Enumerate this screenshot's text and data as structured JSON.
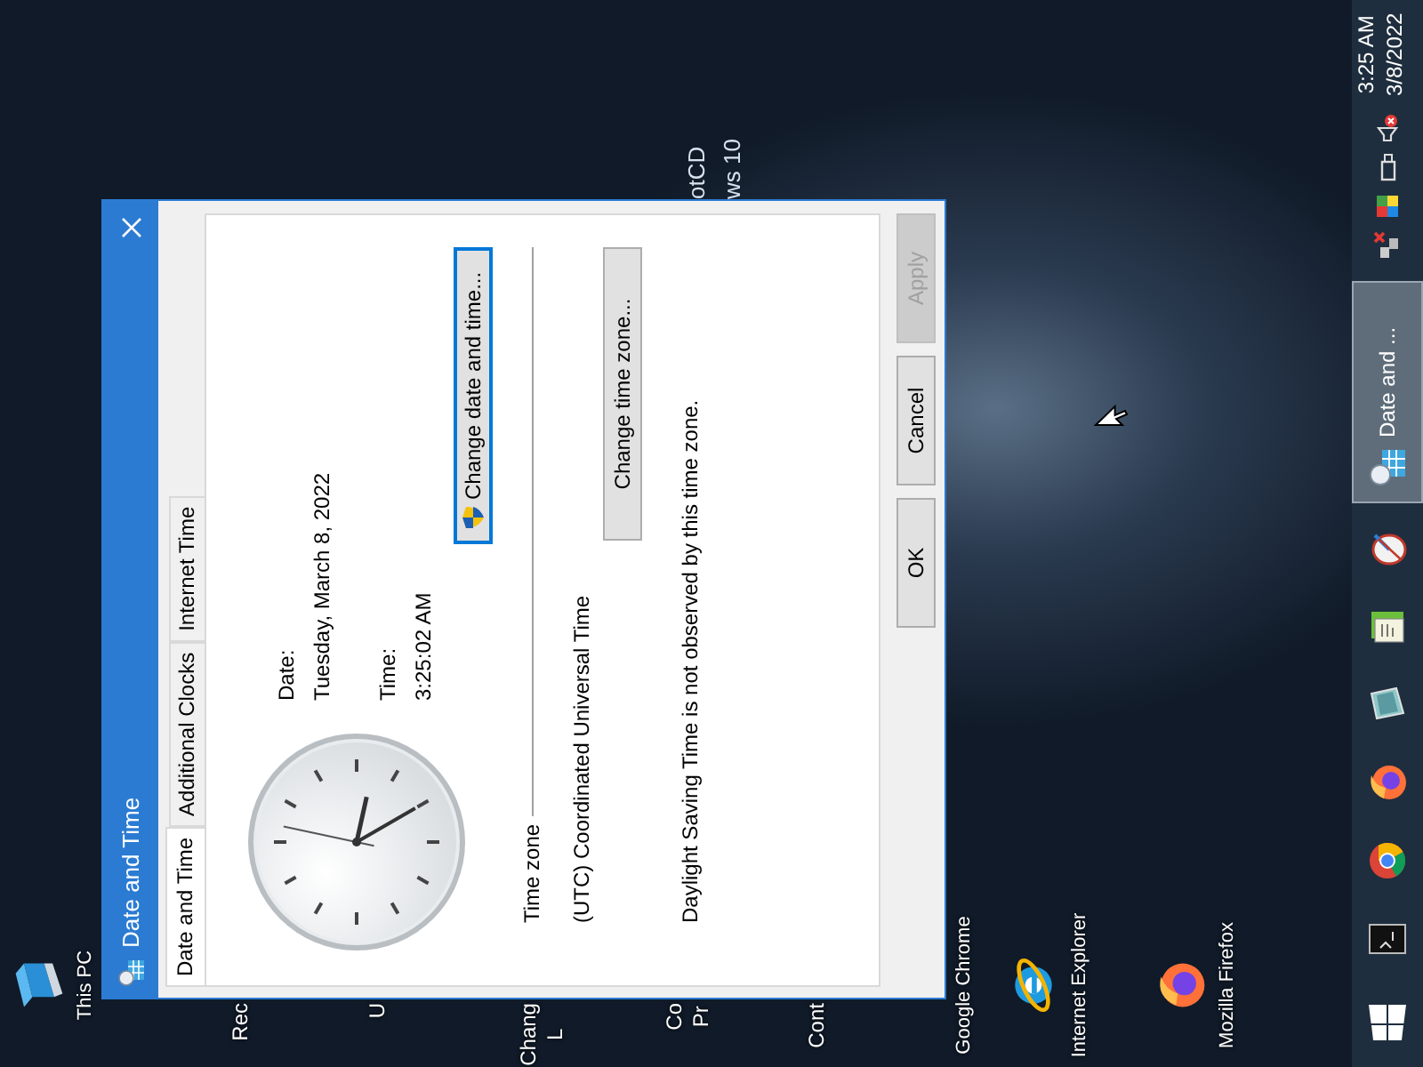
{
  "desktop": {
    "icons": [
      {
        "lines": [
          "This PC"
        ],
        "kind": "icon"
      },
      {
        "lines": [
          "Rec"
        ],
        "kind": "text"
      },
      {
        "lines": [
          "U"
        ],
        "kind": "text"
      },
      {
        "lines": [
          "Chang",
          "L"
        ],
        "kind": "text"
      },
      {
        "lines": [
          "Co",
          "Pr"
        ],
        "kind": "text"
      },
      {
        "lines": [
          "Cont"
        ],
        "kind": "text"
      },
      {
        "lines": [
          "Google Chrome"
        ],
        "kind": "text"
      },
      {
        "lines": [
          "Internet Explorer"
        ],
        "kind": "icon"
      },
      {
        "lines": [
          "Mozilla Firefox"
        ],
        "kind": "icon"
      }
    ],
    "wallpaper_text": [
      "otCD",
      "ws 10"
    ]
  },
  "window": {
    "title": "Date and Time",
    "tabs": [
      {
        "label": "Date and Time",
        "selected": true
      },
      {
        "label": "Additional Clocks",
        "selected": false
      },
      {
        "label": "Internet Time",
        "selected": false
      }
    ],
    "date_label": "Date:",
    "date": "Tuesday, March 8, 2022",
    "time_label": "Time:",
    "time": "3:25:02 AM",
    "change_datetime_button": {
      "label": "Change date and time...",
      "focused": true
    },
    "time_zone": {
      "heading": "Time zone",
      "value": "(UTC) Coordinated Universal Time",
      "button": "Change time zone...",
      "note": "Daylight Saving Time is not observed by this time zone."
    },
    "buttons": [
      {
        "label": "OK",
        "disabled": false
      },
      {
        "label": "Cancel",
        "disabled": false
      },
      {
        "label": "Apply",
        "disabled": true
      }
    ]
  },
  "taskbar": {
    "task": {
      "label": "Date and ...",
      "selected": true
    },
    "clock": {
      "time": "3:25 AM",
      "date": "3/8/2022"
    }
  }
}
